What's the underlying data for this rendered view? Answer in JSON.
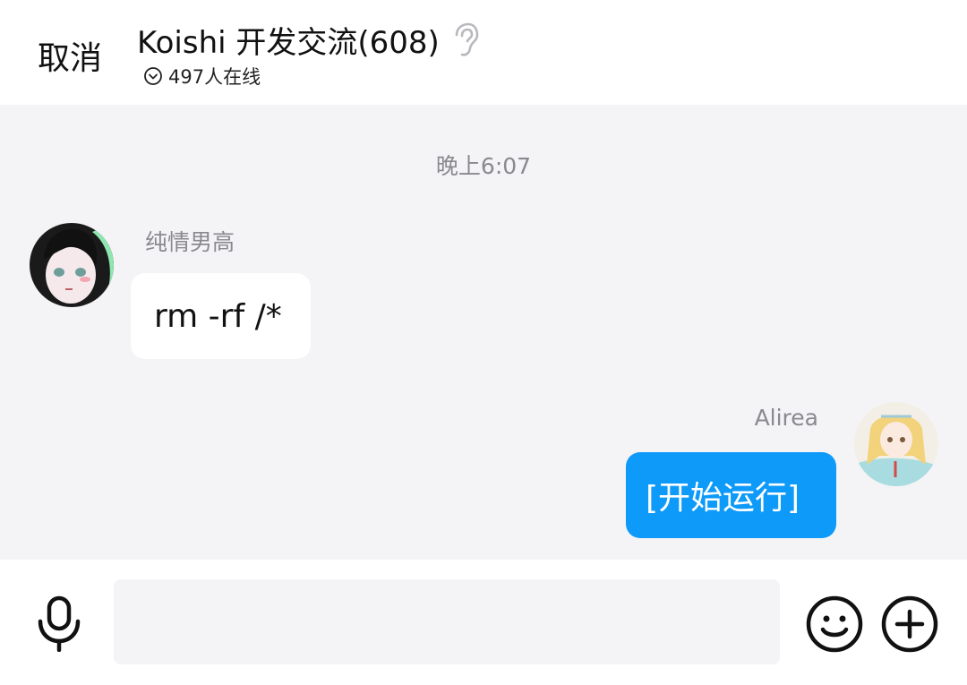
{
  "header": {
    "cancel_label": "取消",
    "title": "Koishi 开发交流(608)",
    "online_text": "497人在线"
  },
  "chat": {
    "timestamp": "晚上6:07",
    "messages": [
      {
        "sender": "纯情男高",
        "text": "rm -rf /*",
        "side": "left"
      },
      {
        "sender": "Alirea",
        "text": "[开始运行]",
        "side": "right"
      }
    ]
  },
  "input": {
    "placeholder": ""
  },
  "colors": {
    "accent": "#0d9af9",
    "background": "#f4f3f6",
    "bubble_left": "#ffffff",
    "meta_text": "#8a8a8e"
  },
  "icons": {
    "ear": "ear-icon",
    "online": "chevron-circle-icon",
    "mic": "microphone-icon",
    "emoji": "smiley-icon",
    "plus": "plus-circle-icon"
  }
}
